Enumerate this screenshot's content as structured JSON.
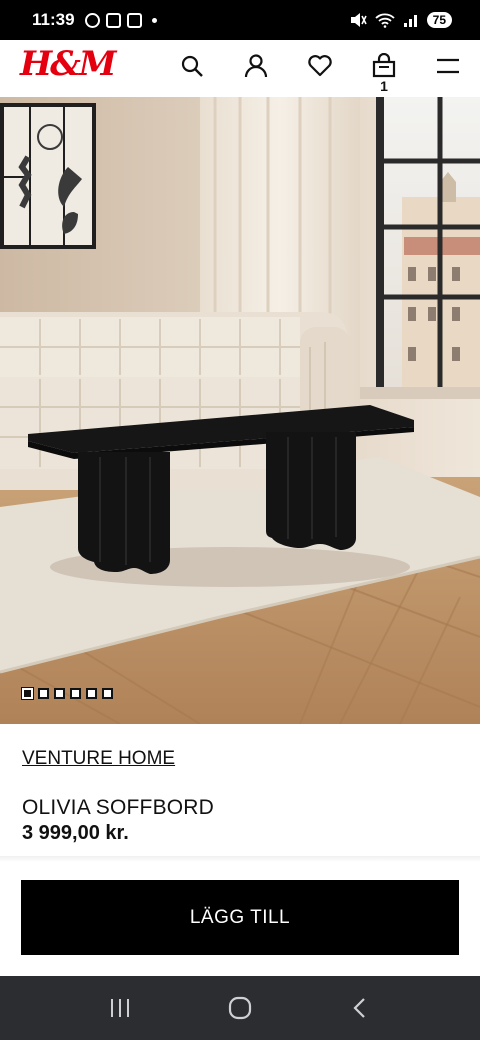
{
  "status_bar": {
    "time": "11:39",
    "battery": "75",
    "icons": [
      "vpn-icon",
      "calendar-icon",
      "screenshot-icon",
      "notification-dot",
      "mute-icon",
      "wifi-icon",
      "signal-icon",
      "battery-icon"
    ]
  },
  "header": {
    "logo": "H&M",
    "icons": [
      "search-icon",
      "account-icon",
      "heart-icon",
      "bag-icon",
      "menu-icon"
    ],
    "bag_count": "1",
    "brand_color": "#e50010"
  },
  "gallery": {
    "image_count": 6,
    "active_index": 0
  },
  "product": {
    "brand": "VENTURE HOME",
    "name": "OLIVIA SOFFBORD",
    "price": "3 999,00 kr."
  },
  "actions": {
    "add_to_cart": "LÄGG TILL"
  },
  "navigation": {
    "icons": [
      "recent-apps-icon",
      "home-icon",
      "back-icon"
    ]
  }
}
